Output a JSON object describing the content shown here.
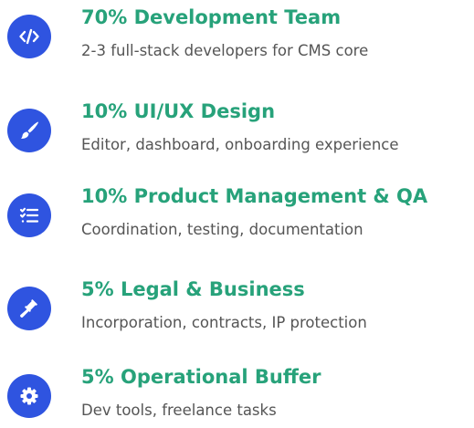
{
  "accent_color": "#27a27a",
  "icon_bg_color": "#2f54e0",
  "text_color": "#555555",
  "items": [
    {
      "icon": "code-icon",
      "title": "70% Development Team",
      "description": "2-3 full-stack developers for CMS core",
      "share_percent": 70
    },
    {
      "icon": "paint-brush-icon",
      "title": "10% UI/UX Design",
      "description": "Editor, dashboard, onboarding experience",
      "share_percent": 10
    },
    {
      "icon": "list-check-icon",
      "title": "10% Product Management & QA",
      "description": "Coordination, testing, documentation",
      "share_percent": 10
    },
    {
      "icon": "gavel-icon",
      "title": "5% Legal & Business",
      "description": "Incorporation, contracts, IP protection",
      "share_percent": 5
    },
    {
      "icon": "gear-icon",
      "title": "5% Operational Buffer",
      "description": "Dev tools, freelance tasks",
      "share_percent": 5
    }
  ]
}
